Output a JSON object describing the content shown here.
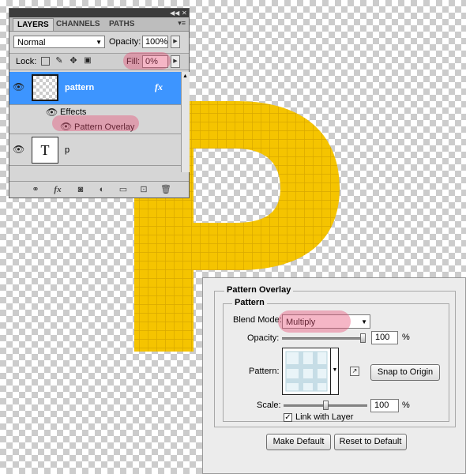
{
  "layers_panel": {
    "tabs": [
      "LAYERS",
      "CHANNELS",
      "PATHS"
    ],
    "blend_mode": "Normal",
    "opacity_label": "Opacity:",
    "opacity_value": "100%",
    "lock_label": "Lock:",
    "fill_label": "Fill:",
    "fill_value": "0%",
    "layers": [
      {
        "name": "pattern",
        "fx": "fx",
        "effects_label": "Effects",
        "effect_name": "Pattern Overlay"
      },
      {
        "name": "p",
        "thumb_glyph": "T"
      }
    ]
  },
  "dialog": {
    "section_title": "Pattern Overlay",
    "group_title": "Pattern",
    "blend_mode_label": "Blend Mode:",
    "blend_mode_value": "Multiply",
    "opacity_label": "Opacity:",
    "opacity_value": "100",
    "opacity_unit": "%",
    "opacity_level": 1.0,
    "pattern_label": "Pattern:",
    "snap_button": "Snap to Origin",
    "scale_label": "Scale:",
    "scale_value": "100",
    "scale_unit": "%",
    "scale_level": 0.5,
    "link_label": "Link with Layer",
    "link_checked": true,
    "make_default_button": "Make Default",
    "reset_default_button": "Reset to Default"
  },
  "colors": {
    "letter_fill": "#f5c400",
    "grid_line": "#d8a800",
    "selection": "#3d95ff",
    "highlight": "#e85078"
  }
}
